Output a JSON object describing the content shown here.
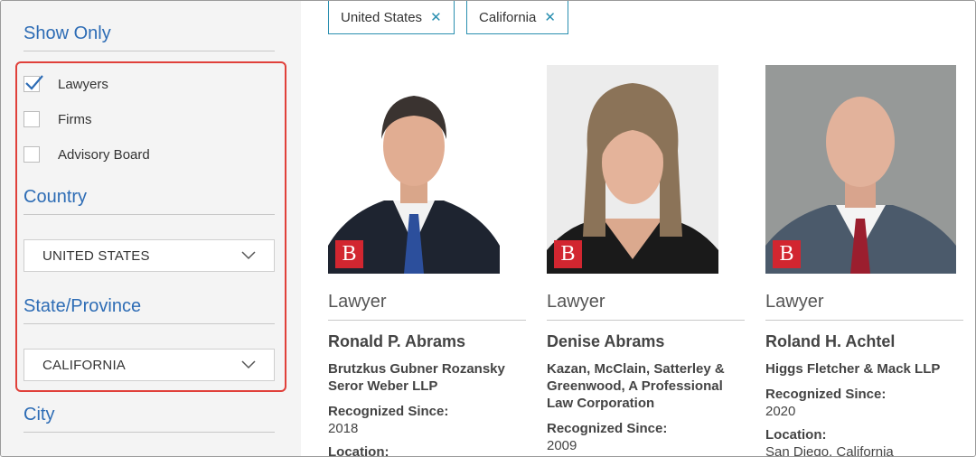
{
  "filters": {
    "show_only": {
      "title": "Show Only",
      "options": [
        {
          "label": "Lawyers",
          "checked": true
        },
        {
          "label": "Firms",
          "checked": false
        },
        {
          "label": "Advisory Board",
          "checked": false
        }
      ]
    },
    "country": {
      "title": "Country",
      "value": "UNITED STATES"
    },
    "state": {
      "title": "State/Province",
      "value": "CALIFORNIA"
    },
    "city": {
      "title": "City"
    }
  },
  "chips": [
    {
      "label": "United States"
    },
    {
      "label": "California"
    }
  ],
  "results": [
    {
      "role": "Lawyer",
      "name": "Ronald P. Abrams",
      "firm": "Brutzkus Gubner Rozansky Seror Weber LLP",
      "recognized_label": "Recognized Since:",
      "recognized": "2018",
      "location_label": "Location:",
      "location": ""
    },
    {
      "role": "Lawyer",
      "name": "Denise Abrams",
      "firm": "Kazan, McClain, Satterley & Greenwood, A Professional Law Corporation",
      "recognized_label": "Recognized Since:",
      "recognized": "2009",
      "location_label": "",
      "location": ""
    },
    {
      "role": "Lawyer",
      "name": "Roland H. Achtel",
      "firm": "Higgs Fletcher & Mack LLP",
      "recognized_label": "Recognized Since:",
      "recognized": "2020",
      "location_label": "Location:",
      "location": "San Diego, California"
    }
  ],
  "badge_letter": "B",
  "colors": {
    "accent": "#2d6cb5",
    "chip_border": "#2a8fb0",
    "highlight": "#e0403a",
    "badge": "#d22630"
  }
}
